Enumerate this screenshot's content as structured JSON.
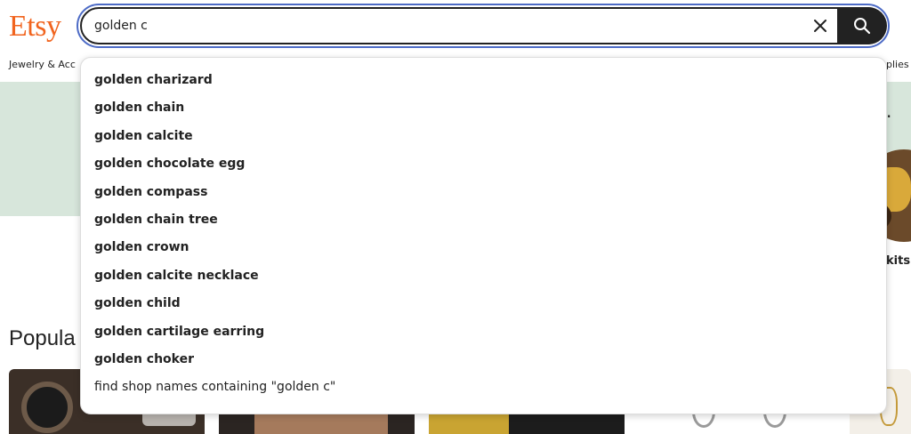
{
  "header": {
    "logo_text": "Etsy",
    "brand_color": "#F1641E",
    "search": {
      "value": "golden c",
      "clear_icon": "close-icon",
      "submit_icon": "search-icon"
    }
  },
  "categories": {
    "left_label": "Jewelry & Acc",
    "right_label": "plies"
  },
  "banner": {
    "punctuation": ".",
    "circle_label": "kits"
  },
  "section": {
    "title": "Popula"
  },
  "autocomplete": {
    "suggestions": [
      "golden charizard",
      "golden chain",
      "golden calcite",
      "golden chocolate egg",
      "golden compass",
      "golden chain tree",
      "golden crown",
      "golden calcite necklace",
      "golden child",
      "golden cartilage earring",
      "golden choker"
    ],
    "shop_search": "find shop names containing \"golden c\""
  },
  "colors": {
    "banner_bg": "#D7E6DB",
    "focus_ring": "#4D6BC6",
    "search_button": "#222222"
  }
}
